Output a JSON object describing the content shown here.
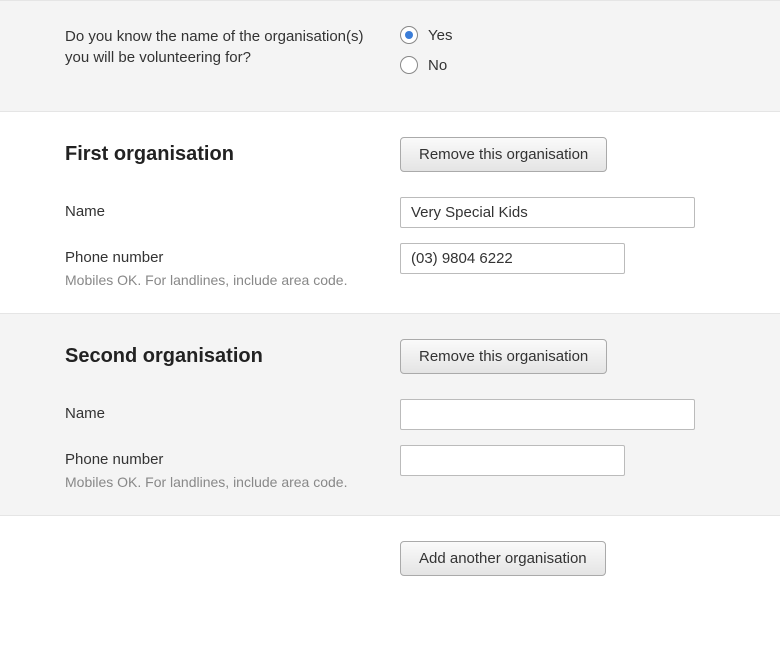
{
  "question": {
    "text": "Do you know the name of the organisation(s) you will be volunteering for?",
    "options": {
      "yes": "Yes",
      "no": "No"
    },
    "selected": "yes"
  },
  "org1": {
    "title": "First organisation",
    "remove_label": "Remove this organisation",
    "name_label": "Name",
    "name_value": "Very Special Kids",
    "phone_label": "Phone number",
    "phone_value": "(03) 9804 6222",
    "phone_hint": "Mobiles OK. For landlines, include area code."
  },
  "org2": {
    "title": "Second organisation",
    "remove_label": "Remove this organisation",
    "name_label": "Name",
    "name_value": "",
    "phone_label": "Phone number",
    "phone_value": "",
    "phone_hint": "Mobiles OK. For landlines, include area code."
  },
  "add_label": "Add another organisation"
}
